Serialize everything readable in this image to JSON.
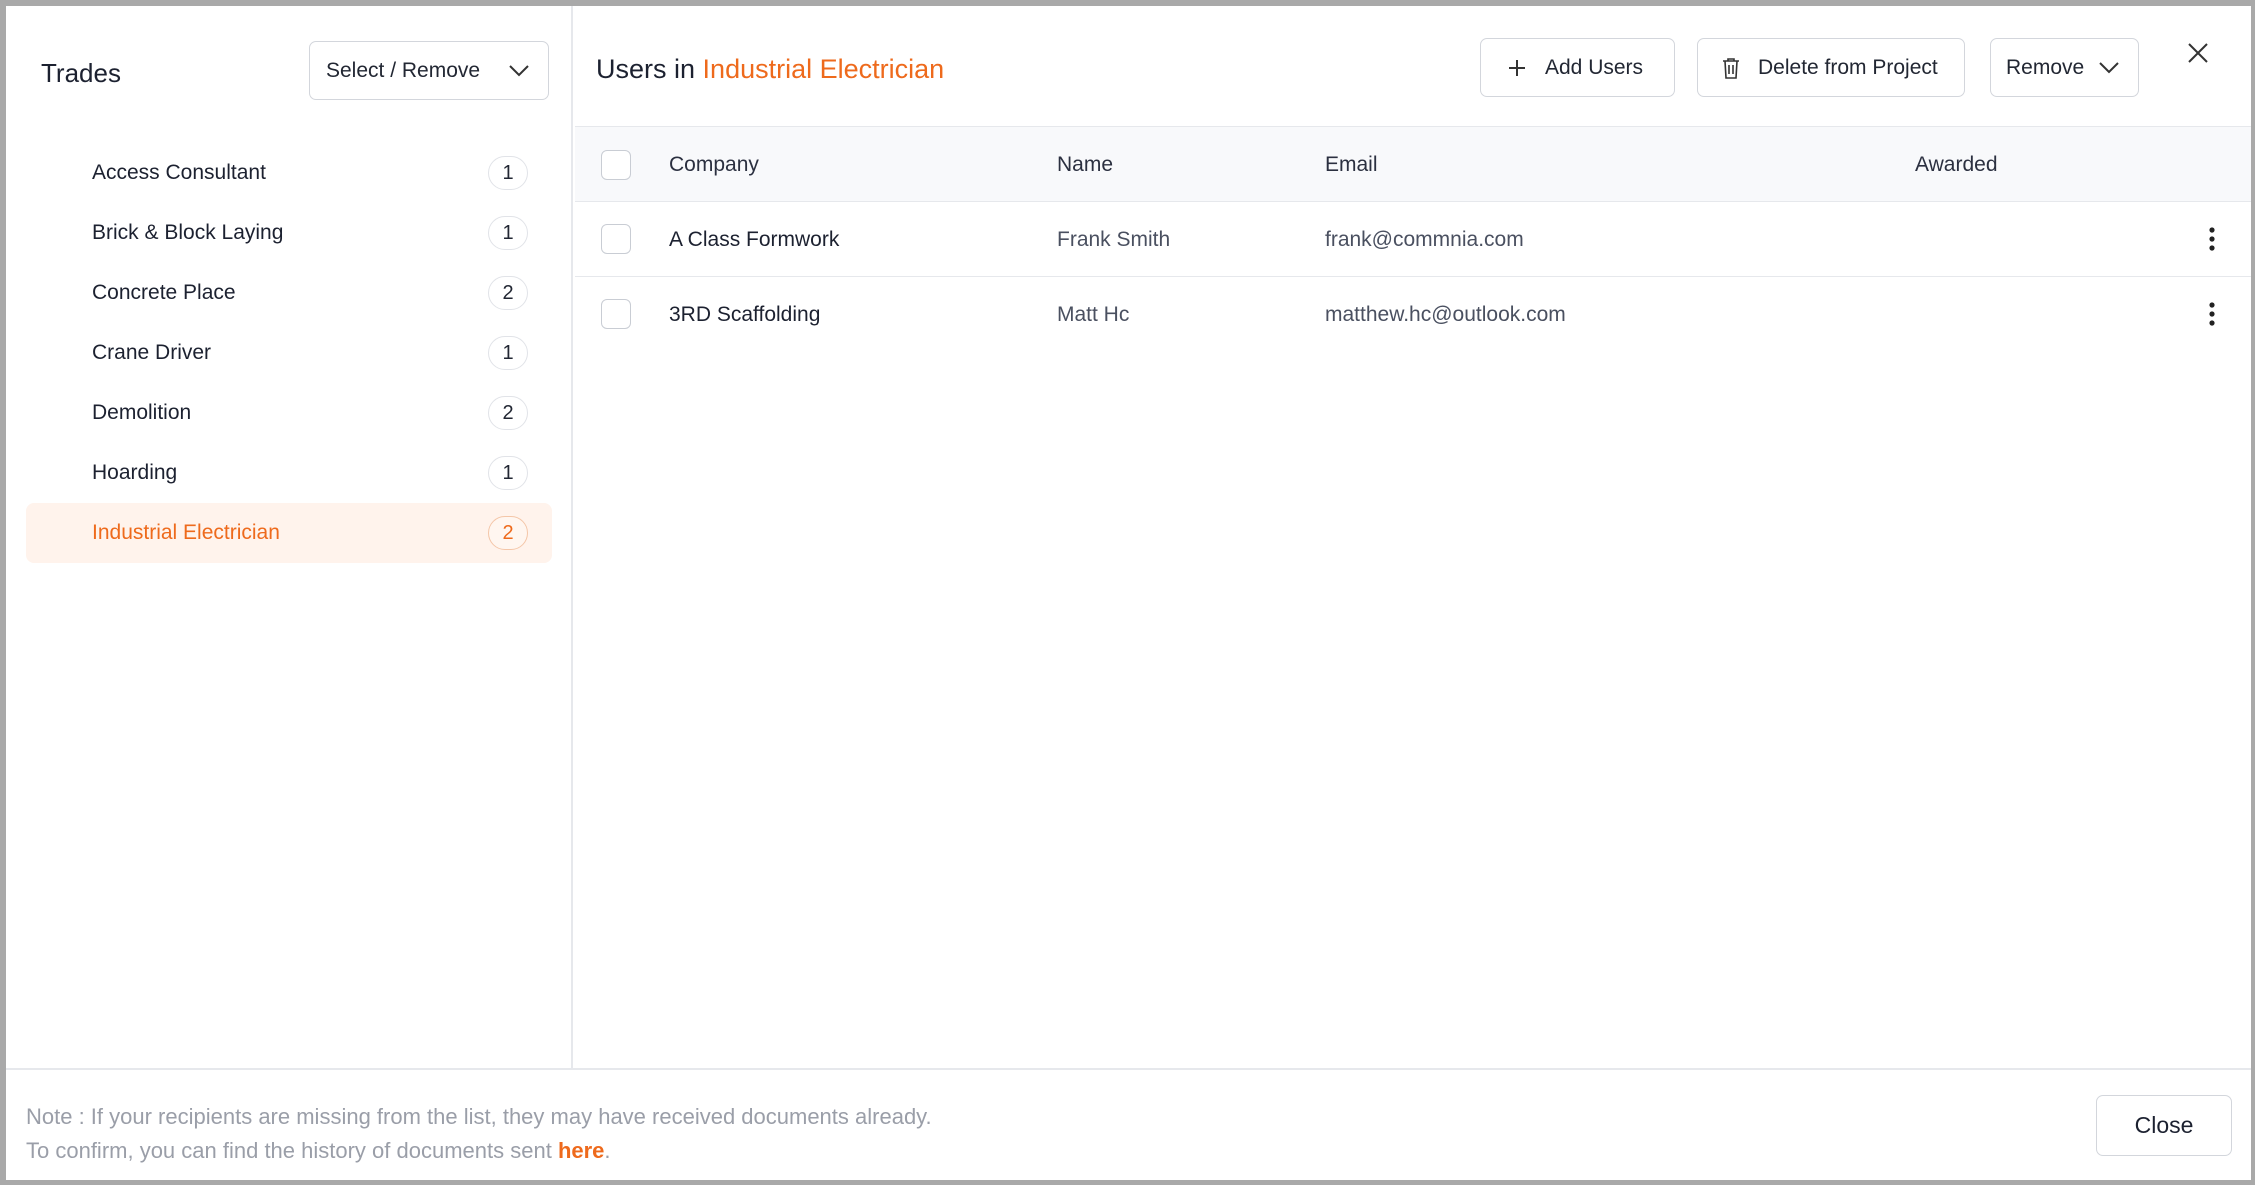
{
  "left_panel": {
    "title": "Trades",
    "select_button_label": "Select / Remove",
    "trades": [
      {
        "name": "Access Consultant",
        "count": "1",
        "active": false
      },
      {
        "name": "Brick & Block Laying",
        "count": "1",
        "active": false
      },
      {
        "name": "Concrete Place",
        "count": "2",
        "active": false
      },
      {
        "name": "Crane Driver",
        "count": "1",
        "active": false
      },
      {
        "name": "Demolition",
        "count": "2",
        "active": false
      },
      {
        "name": "Hoarding",
        "count": "1",
        "active": false
      },
      {
        "name": "Industrial Electrician",
        "count": "2",
        "active": true
      }
    ]
  },
  "right_panel": {
    "title_prefix": "Users in",
    "title_trade": "Industrial Electrician",
    "add_users_label": "Add Users",
    "delete_label": "Delete from Project",
    "remove_label": "Remove",
    "columns": {
      "company": "Company",
      "name": "Name",
      "email": "Email",
      "awarded": "Awarded"
    },
    "rows": [
      {
        "company": "A Class Formwork",
        "name": "Frank Smith",
        "email": "frank@commnia.com",
        "awarded": ""
      },
      {
        "company": "3RD Scaffolding",
        "name": "Matt Hc",
        "email": "matthew.hc@outlook.com",
        "awarded": ""
      }
    ]
  },
  "footer": {
    "note_line1": "Note : If your recipients are missing from the list, they may have received documents already.",
    "note_line2_prefix": "To confirm, you can find the history of documents sent ",
    "note_link": "here",
    "note_line2_suffix": ".",
    "close_label": "Close"
  },
  "colors": {
    "accent": "#ee6a1c",
    "active_bg": "#fff3ec",
    "border": "#d3d6dc"
  },
  "icons": {
    "select": "chevron-down-icon",
    "add": "plus-icon",
    "delete": "trash-icon",
    "remove": "chevron-down-icon",
    "close": "close-icon",
    "row_menu": "kebab-menu-icon"
  }
}
